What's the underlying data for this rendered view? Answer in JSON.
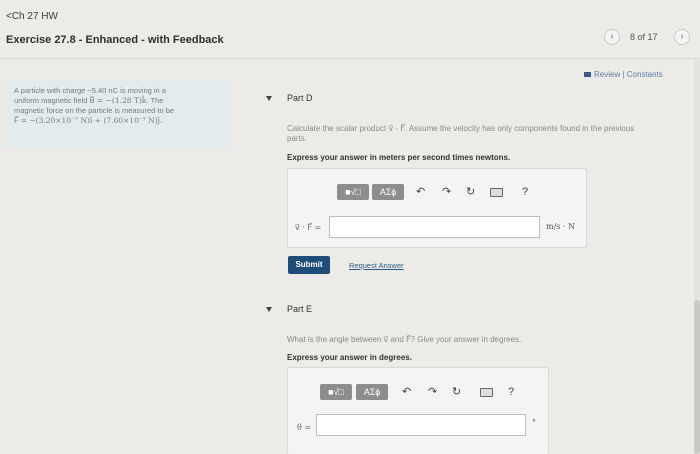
{
  "header": {
    "back_label": "<Ch 27 HW",
    "exercise_title": "Exercise 27.8 - Enhanced - with Feedback",
    "pager": {
      "prev_icon": "chevron-left-icon",
      "next_icon": "chevron-right-icon",
      "count": "8 of 17"
    }
  },
  "problem": {
    "line1_a": "A particle with charge ",
    "line1_b": "−5.40 nC",
    "line1_c": " is moving in a",
    "line2_a": "uniform magnetic field ",
    "line2_b": "B⃗ = −(1.28 T)k̂",
    "line2_c": ". The",
    "line3": "magnetic force on the particle is measured to be",
    "line4": "F⃗ = −(3.20×10⁻⁷ N)î + (7.60×10⁻⁷ N)ĵ."
  },
  "review": {
    "label": "Review | Constants"
  },
  "part_d": {
    "title": "Part D",
    "question_line1": "Calculate the scalar product v⃗ · F⃗. Assume the velocity has only components found in the previous",
    "question_line2": "parts.",
    "instruction": "Express your answer in meters per second times newtons.",
    "toolbar": {
      "templates_label": "■√□",
      "symbols_label": "AΣϕ"
    },
    "eq_label": "v⃗ · F⃗ =",
    "input_value": "",
    "unit": "m/s · N",
    "submit_label": "Submit",
    "request_label": "Request Answer"
  },
  "part_e": {
    "title": "Part E",
    "question": "What is the angle between v⃗ and F⃗? Give your answer in degrees.",
    "instruction": "Express your answer in degrees.",
    "toolbar": {
      "templates_label": "■√□",
      "symbols_label": "AΣϕ"
    },
    "eq_label": "θ =",
    "input_value": "",
    "unit": "°"
  },
  "icons": {
    "undo": "↶",
    "redo": "↷",
    "reset": "↻",
    "help": "?"
  },
  "colors": {
    "submit": "#1f4d7a",
    "link": "#2a5b8c",
    "problem_bg": "#e2ecec",
    "review_icon": "#3b5a86"
  }
}
